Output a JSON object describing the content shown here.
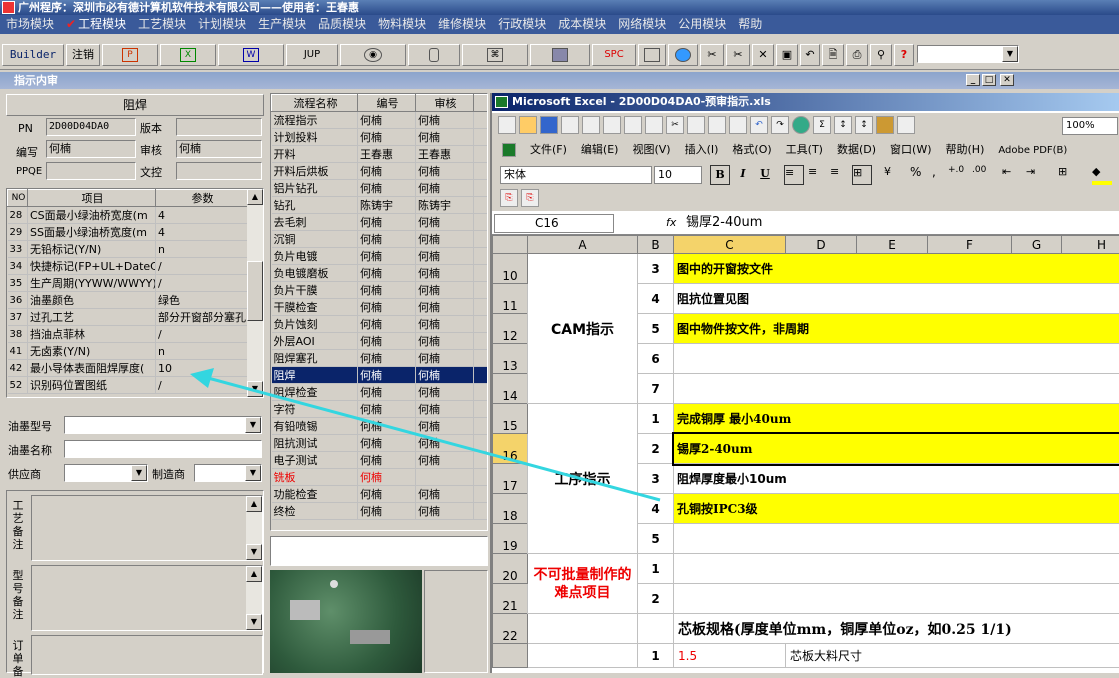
{
  "window": {
    "title": "广州程序：深圳市必有德计算机软件技术有限公司——使用者：王春惠"
  },
  "menu": [
    "市场模块",
    "工程模块",
    "工艺模块",
    "计划模块",
    "生产模块",
    "品质模块",
    "物料模块",
    "维修模块",
    "行政模块",
    "成本模块",
    "网络模块",
    "公用模块",
    "帮助"
  ],
  "toolbar": {
    "builder": "Builder",
    "logout": "注销",
    "jup": "JUP",
    "spc": "SPC",
    "icons": [
      "ppt-icon",
      "excel-icon",
      "word-icon",
      "jup-icon",
      "eye-icon",
      "database-icon",
      "network-icon",
      "computer-icon",
      "spc-icon",
      "window-icon",
      "ie-icon",
      "cut-icon",
      "close-icon",
      "save-icon",
      "undo-icon",
      "preview-icon",
      "print-icon",
      "find-icon",
      "help-icon"
    ]
  },
  "subwindow": {
    "title": "指示内审"
  },
  "left": {
    "section_title": "阻焊",
    "pn_label": "PN",
    "pn_value": "2D00D04DA0",
    "version_label": "版本",
    "version_value": "",
    "writer_label": "编写",
    "writer_value": "何楠",
    "reviewer_label": "审核",
    "reviewer_value": "何楠",
    "ppqe_label": "PPQE",
    "ppqe_value": "",
    "wenkong_label": "文控",
    "wenkong_value": "",
    "param_headers": [
      "NO",
      "项目",
      "参数"
    ],
    "params": [
      {
        "no": "28",
        "item": "CS面最小绿油桥宽度(m",
        "value": "4"
      },
      {
        "no": "29",
        "item": "SS面最小绿油桥宽度(m",
        "value": "4"
      },
      {
        "no": "33",
        "item": "无铅标记(Y/N)",
        "value": "n"
      },
      {
        "no": "34",
        "item": "快捷标记(FP+UL+DateCo",
        "value": "/"
      },
      {
        "no": "35",
        "item": "生产周期(YYWW/WWYY)",
        "value": "/"
      },
      {
        "no": "36",
        "item": "油墨颜色",
        "value": "绿色"
      },
      {
        "no": "37",
        "item": "过孔工艺",
        "value": "部分开窗部分塞孔"
      },
      {
        "no": "38",
        "item": "挡油点菲林",
        "value": "/"
      },
      {
        "no": "41",
        "item": "无卤素(Y/N)",
        "value": "n"
      },
      {
        "no": "42",
        "item": "最小导体表面阻焊厚度(",
        "value": "10"
      },
      {
        "no": "52",
        "item": "识别码位置图纸",
        "value": "/"
      }
    ],
    "ink_model_label": "油墨型号",
    "ink_name_label": "油墨名称",
    "supplier_label": "供应商",
    "maker_label": "制造商",
    "process_note_label": "工艺备注",
    "model_note_label": "型号备注",
    "order_note_label": "订单备"
  },
  "process": {
    "headers": [
      "流程名称",
      "编号",
      "审核"
    ],
    "rows": [
      {
        "name": "流程指示",
        "code": "何楠",
        "review": "何楠",
        "red": false
      },
      {
        "name": "计划投料",
        "code": "何楠",
        "review": "何楠",
        "red": false
      },
      {
        "name": "开料",
        "code": "王春惠",
        "review": "王春惠",
        "red": false
      },
      {
        "name": "开料后烘板",
        "code": "何楠",
        "review": "何楠",
        "red": false
      },
      {
        "name": "铝片钻孔",
        "code": "何楠",
        "review": "何楠",
        "red": false
      },
      {
        "name": "钻孔",
        "code": "陈铸宇",
        "review": "陈铸宇",
        "red": false
      },
      {
        "name": "去毛刺",
        "code": "何楠",
        "review": "何楠",
        "red": false
      },
      {
        "name": "沉铜",
        "code": "何楠",
        "review": "何楠",
        "red": false
      },
      {
        "name": "负片电镀",
        "code": "何楠",
        "review": "何楠",
        "red": false
      },
      {
        "name": "负电镀磨板",
        "code": "何楠",
        "review": "何楠",
        "red": false
      },
      {
        "name": "负片干膜",
        "code": "何楠",
        "review": "何楠",
        "red": false
      },
      {
        "name": "干膜检查",
        "code": "何楠",
        "review": "何楠",
        "red": false
      },
      {
        "name": "负片蚀刻",
        "code": "何楠",
        "review": "何楠",
        "red": false
      },
      {
        "name": "外层AOI",
        "code": "何楠",
        "review": "何楠",
        "red": false
      },
      {
        "name": "阻焊塞孔",
        "code": "何楠",
        "review": "何楠",
        "red": false
      },
      {
        "name": "阻焊",
        "code": "何楠",
        "review": "何楠",
        "red": false
      },
      {
        "name": "阻焊检查",
        "code": "何楠",
        "review": "何楠",
        "red": false
      },
      {
        "name": "字符",
        "code": "何楠",
        "review": "何楠",
        "red": false
      },
      {
        "name": "有铅喷锡",
        "code": "何楠",
        "review": "何楠",
        "red": false
      },
      {
        "name": "阻抗测试",
        "code": "何楠",
        "review": "何楠",
        "red": false
      },
      {
        "name": "电子测试",
        "code": "何楠",
        "review": "何楠",
        "red": false
      },
      {
        "name": "铣板",
        "code": "何楠",
        "review": "",
        "red": true
      },
      {
        "name": "功能检查",
        "code": "何楠",
        "review": "何楠",
        "red": false
      },
      {
        "name": "终检",
        "code": "何楠",
        "review": "何楠",
        "red": false
      }
    ],
    "selected_index": 15
  },
  "excel": {
    "title": "Microsoft Excel - 2D00D04DA0-预审指示.xls",
    "menu": [
      "文件(F)",
      "编辑(E)",
      "视图(V)",
      "插入(I)",
      "格式(O)",
      "工具(T)",
      "数据(D)",
      "窗口(W)",
      "帮助(H)",
      "Adobe PDF(B)"
    ],
    "zoom": "100%",
    "font_name": "宋体",
    "font_size": "10",
    "cell_ref": "C16",
    "formula": "锡厚2-40um",
    "fx": "fx",
    "format_sym": {
      "bold": "B",
      "italic": "I",
      "underline": "U",
      "sum": "Σ",
      "percent": "%",
      "comma": ","
    },
    "columns": [
      "A",
      "B",
      "C",
      "D",
      "E",
      "F",
      "G",
      "H"
    ],
    "rows": [
      {
        "row": "10",
        "b": "3",
        "c": "图中的开窗按文件",
        "yellow": true
      },
      {
        "row": "11",
        "b": "4",
        "c": "阻抗位置见图",
        "yellow": false
      },
      {
        "row": "12",
        "b": "5",
        "c": "图中物件按文件，非周期",
        "yellow": true
      },
      {
        "row": "13",
        "b": "6",
        "c": "",
        "yellow": false
      },
      {
        "row": "14",
        "b": "7",
        "c": "",
        "yellow": false
      },
      {
        "row": "15",
        "b": "1",
        "c": "完成铜厚 最小40um",
        "yellow": true
      },
      {
        "row": "16",
        "b": "2",
        "c": "锡厚2-40um",
        "yellow": true
      },
      {
        "row": "17",
        "b": "3",
        "c": "阻焊厚度最小10um",
        "yellow": false
      },
      {
        "row": "18",
        "b": "4",
        "c": "孔铜按IPC3级",
        "yellow": true
      },
      {
        "row": "19",
        "b": "5",
        "c": "",
        "yellow": false
      },
      {
        "row": "20",
        "b": "1",
        "c": "",
        "yellow": false
      },
      {
        "row": "21",
        "b": "2",
        "c": "",
        "yellow": false
      }
    ],
    "groups": {
      "cam": "CAM指示",
      "process": "工序指示",
      "difficult": "不可批量制作的难点项目"
    },
    "row22": {
      "row": "22",
      "text": "芯板规格(厚度单位mm，铜厚单位oz，如0.25 1/1)"
    },
    "row23_partial": {
      "b": "1",
      "a": "1.5",
      "c": "芯板大料尺寸"
    }
  },
  "colors": {
    "selection": "#0a246a",
    "yellow": "#ffff00",
    "arrow": "#33d6e0",
    "red_text": "#e00000"
  }
}
